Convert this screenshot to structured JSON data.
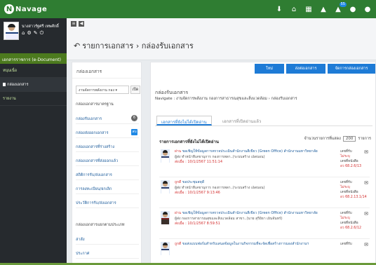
{
  "app": {
    "logo_letter": "N",
    "logo_text": "Navage"
  },
  "topbar": {
    "icons": [
      {
        "name": "download-icon",
        "glyph": "⬇"
      },
      {
        "name": "home-icon",
        "glyph": "⌂"
      },
      {
        "name": "calendar-icon",
        "glyph": "▦"
      },
      {
        "name": "bell-icon",
        "glyph": "▲"
      },
      {
        "name": "notification-icon",
        "glyph": "▲",
        "badge": "55"
      },
      {
        "name": "chat-icon",
        "glyph": "●"
      },
      {
        "name": "user-icon",
        "glyph": "●"
      }
    ]
  },
  "sidebar": {
    "user_name": "นางสาวรัฐศรี เทพศักดิ์",
    "section": "เอกสารราชการ (e-Document)",
    "items": [
      {
        "label": "หนุนเนื่อ",
        "active": false
      },
      {
        "label": "กล่องเอกสาร",
        "active": true
      },
      {
        "label": "รายงาน",
        "active": false
      }
    ]
  },
  "header": {
    "title": "รายการเอกสาร › กล่องรับเอกสาร"
  },
  "left_panel": {
    "title": "กล่องเอกสาร",
    "select_value": "งานจัดการพลังงาน กอง ▾",
    "go_label": "เปิด",
    "group1": "กล่องเอกสารมาตรฐาน",
    "items1": [
      {
        "label": "กล่องรับเอกสาร",
        "count": "6",
        "count_style": "grey"
      },
      {
        "label": "กล่องส่งออกเอกสาร",
        "count": "ลบ",
        "count_style": "blue"
      },
      {
        "label": "กล่องเอกสารที่ร่างสร้าง",
        "count": ""
      },
      {
        "label": "กล่องเอกสารที่ส่งออกแล้ว",
        "count": ""
      },
      {
        "label": "สถิติการรับ/ส่งเอกสาร",
        "count": ""
      },
      {
        "label": "การลงทะเบียน/ยกเลิก",
        "count": ""
      },
      {
        "label": "ประวัติการรับ/ส่งเอกสาร",
        "count": ""
      }
    ],
    "group2": "กล่องเอกสารแยกตามประเภท",
    "items2": [
      {
        "label": "ล่าสัง"
      },
      {
        "label": "ประกาศ"
      }
    ]
  },
  "main_panel": {
    "buttons": [
      "ใหม่",
      "ส่งต่อเอกสาร",
      "จัดการกล่องเอกสาร"
    ],
    "heading": "กล่องรับเอกสาร",
    "breadcrumb": "Navigate : งานจัดการพลังงาน กองการสาธารณสุขและสิ่งแวดล้อม › กล่องรับเอกสาร",
    "tabs": [
      "เอกสารที่ยังไม่ได้เปิดอ่าน",
      "เอกสารที่เปิดอ่านแล้ว"
    ],
    "list_title": "รายการเอกสารที่ยังไม่ได้เปิดอ่าน",
    "page_size_label": "จำนวนรายการที่แสดง",
    "page_size_value": "200",
    "page_size_suffix": "รายการ",
    "rows": [
      {
        "from": "ผ่าน",
        "subject": "ขอเชิญให้ข้อมูลการตรวจประเมินสำนักงานสีเขียว (Green Office) สำนักงานมหาวิทยาลัย",
        "sender": "ผู้ส่ง ทำหน้าที่เลขานุการ กองการพลา..(ระบบสร้าง เอ็ดบอน)",
        "date": "ส่งเมื่อ : 10/1/2567 11:51:14",
        "status_label": "เลขที่รับ",
        "status": "ไม่ระบุ",
        "doc_label": "เลขที่หนังสือ",
        "doc_no": "อว 68.2.6/13",
        "photo": "light"
      },
      {
        "from": "ถูกดี",
        "subject": "ขอประชุมสดุดี",
        "sender": "ผู้ส่ง ทำหน้าที่เลขานุการ กองการพลา..(ระบบสร้าง เอ็ดบอน)",
        "date": "ส่งเมื่อ : 10/1/2567 9:13:46",
        "status_label": "เลขที่รับ",
        "status": "ไม่ระบุ",
        "doc_label": "เลขที่หนังสือ",
        "doc_no": "อว 68.2.13.1/14",
        "photo": "light"
      },
      {
        "from": "ผ่าน",
        "subject": "ขอเชิญให้ข้อมูลการตรวจประเมินสำนักงานสีเขียว (Green Office) สำนักงานมหาวิทยาลัย",
        "sender": "ผู้ส่ง กองการสาธารณสุขและสิ่งแวดล้อม สาขา..(นาย สุรีย์ธา เย็นจันทร์)",
        "date": "ส่งเมื่อ : 10/1/2567 8:59:51",
        "status_label": "เลขที่รับ",
        "status": "ไม่ระบุ",
        "doc_label": "เลขที่หนังสือ",
        "doc_no": "อว 68.2.6/12",
        "photo": "dark"
      },
      {
        "from": "ถูกดี",
        "subject": "ขอส่งแบบฟอร์มสำหรับเสนอข้อมูลในงานกิจกรรมที่จะจัดเพื่อสร้างการมองสำนักงานฯ",
        "sender": "",
        "date": "",
        "status_label": "เลขที่รับ",
        "status": "",
        "doc_label": "",
        "doc_no": "",
        "photo": "light"
      }
    ]
  },
  "colors": {
    "topbar": "#2f7d32",
    "sidebar": "#262a2e",
    "sidebar_section": "#4c7a1e",
    "accent_blue": "#1e7bd6",
    "alert_red": "#d32f2f"
  }
}
